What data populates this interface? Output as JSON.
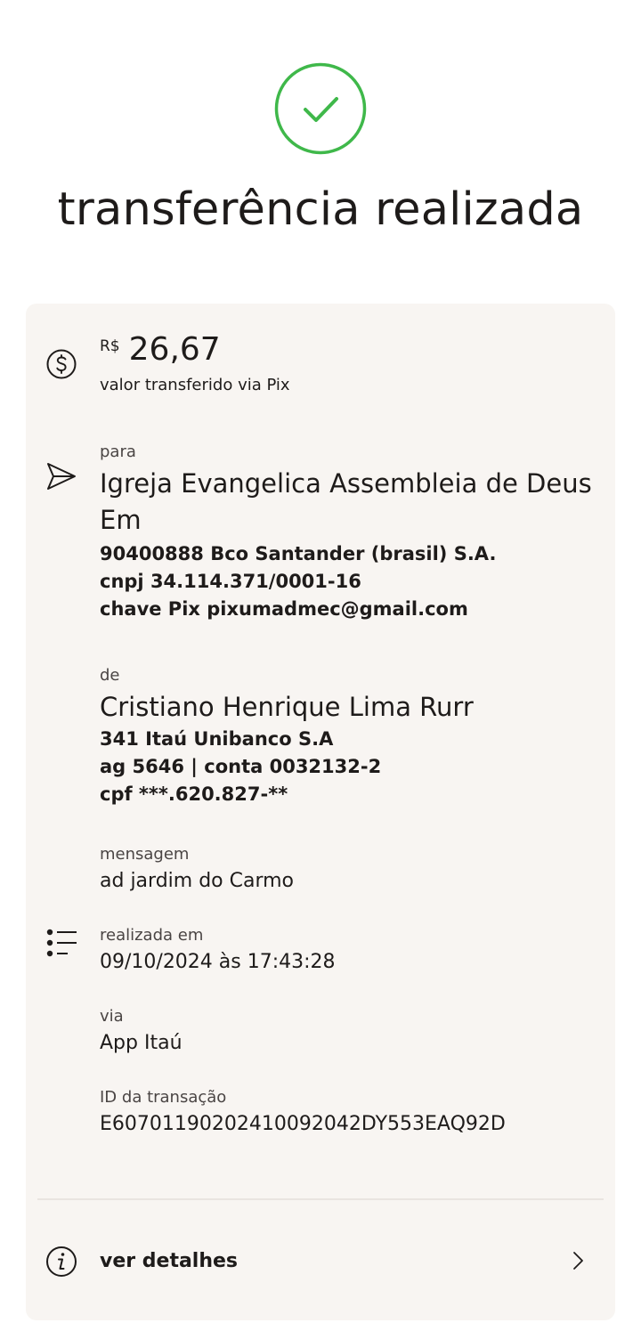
{
  "header": {
    "title": "transferência realizada",
    "success_icon": "check-circle-icon",
    "success_color": "#3fb84a"
  },
  "amount": {
    "currency": "R$",
    "value": "26,67",
    "caption": "valor transferido via Pix",
    "icon": "dollar-circle-icon"
  },
  "recipient": {
    "label": "para",
    "name": "Igreja Evangelica Assembleia de Deus Em",
    "bank": "90400888 Bco Santander (brasil) S.A.",
    "document": "cnpj 34.114.371/0001-16",
    "pix_key": "chave Pix pixumadmec@gmail.com",
    "icon": "send-icon"
  },
  "sender": {
    "label": "de",
    "name": "Cristiano Henrique Lima Rurr",
    "bank": "341 Itaú Unibanco S.A",
    "account": "ag 5646 | conta 0032132-2",
    "document": "cpf ***.620.827-**"
  },
  "message": {
    "label": "mensagem",
    "value": "ad jardim do Carmo"
  },
  "date": {
    "label": "realizada em",
    "value": "09/10/2024 às 17:43:28",
    "icon": "list-icon"
  },
  "channel": {
    "label": "via",
    "value": "App Itaú"
  },
  "transaction": {
    "label": "ID da transação",
    "value": "E60701190202410092042DY553EAQ92D"
  },
  "footer": {
    "details_label": "ver detalhes",
    "info_icon": "info-icon",
    "chevron_icon": "chevron-right-icon"
  },
  "colors": {
    "card_background": "#f8f5f2",
    "text": "#1e1b1a",
    "muted_text": "#4a4544"
  }
}
